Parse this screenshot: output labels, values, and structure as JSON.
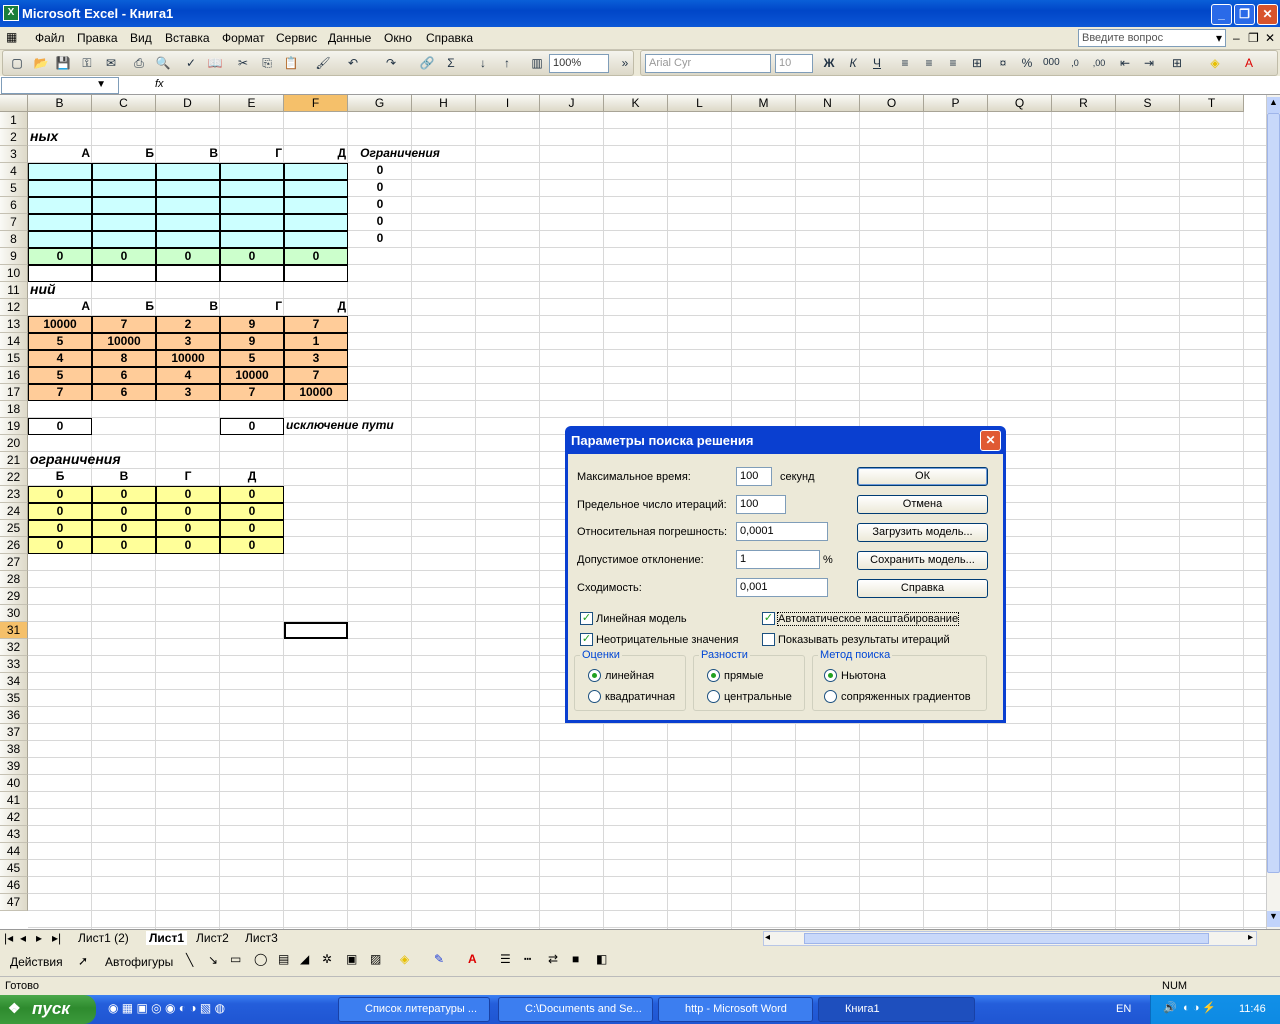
{
  "window": {
    "title": "Microsoft Excel - Книга1"
  },
  "menu": {
    "items": [
      "Файл",
      "Правка",
      "Вид",
      "Вставка",
      "Формат",
      "Сервис",
      "Данные",
      "Окно",
      "Справка"
    ],
    "ask_placeholder": "Введите вопрос"
  },
  "toolbar": {
    "zoom": "100%",
    "font": "Arial Cyr",
    "size": "10"
  },
  "formula": {
    "fx": "fx"
  },
  "columns": [
    "B",
    "C",
    "D",
    "E",
    "F",
    "G",
    "H",
    "I",
    "J",
    "K",
    "L",
    "M",
    "N",
    "O",
    "P",
    "Q",
    "R",
    "S",
    "T"
  ],
  "selected_column": "F",
  "selected_row": 31,
  "rows_count": 47,
  "cells": {
    "r2_label": "ных",
    "r3": [
      "А",
      "Б",
      "В",
      "Г",
      "Д"
    ],
    "r3_g": "Ограничения",
    "g4_8": [
      "0",
      "0",
      "0",
      "0",
      "0"
    ],
    "r9": [
      "0",
      "0",
      "0",
      "0",
      "0"
    ],
    "r11_label": "ний",
    "r12": [
      "А",
      "Б",
      "В",
      "Г",
      "Д"
    ],
    "matrix": [
      [
        "10000",
        "7",
        "2",
        "9",
        "7"
      ],
      [
        "5",
        "10000",
        "3",
        "9",
        "1"
      ],
      [
        "4",
        "8",
        "10000",
        "5",
        "3"
      ],
      [
        "5",
        "6",
        "4",
        "10000",
        "7"
      ],
      [
        "7",
        "6",
        "3",
        "7",
        "10000"
      ]
    ],
    "b19": "0",
    "e19": "0",
    "f19_label": "исключение пути",
    "r21_label": "ограничения",
    "r22": [
      "Б",
      "В",
      "Г",
      "Д"
    ],
    "yellow": [
      [
        "0",
        "0",
        "0",
        "0"
      ],
      [
        "0",
        "0",
        "0",
        "0"
      ],
      [
        "0",
        "0",
        "0",
        "0"
      ],
      [
        "0",
        "0",
        "0",
        "0"
      ]
    ]
  },
  "sheet_tabs": [
    "Лист1 (2)",
    "Лист1",
    "Лист2",
    "Лист3"
  ],
  "active_sheet": "Лист1",
  "drawing": {
    "actions": "Действия",
    "autoshapes": "Автофигуры"
  },
  "status": {
    "ready": "Готово",
    "num": "NUM"
  },
  "taskbar": {
    "start": "пуск",
    "tasks": [
      "Список литературы ...",
      "C:\\Documents and Se...",
      "http - Microsoft Word",
      "Книга1"
    ],
    "lang": "EN",
    "time": "11:46"
  },
  "dialog": {
    "title": "Параметры поиска решения",
    "fields": [
      {
        "label": "Максимальное время:",
        "value": "100",
        "unit": "секунд"
      },
      {
        "label": "Предельное число итераций:",
        "value": "100",
        "unit": ""
      },
      {
        "label": "Относительная погрешность:",
        "value": "0,0001",
        "unit": ""
      },
      {
        "label": "Допустимое отклонение:",
        "value": "1",
        "unit": "%"
      },
      {
        "label": "Сходимость:",
        "value": "0,001",
        "unit": ""
      }
    ],
    "buttons": [
      "ОК",
      "Отмена",
      "Загрузить модель...",
      "Сохранить модель...",
      "Справка"
    ],
    "checks": [
      {
        "label": "Линейная модель",
        "checked": true
      },
      {
        "label": "Автоматическое масштабирование",
        "checked": true
      },
      {
        "label": "Неотрицательные значения",
        "checked": true
      },
      {
        "label": "Показывать результаты итераций",
        "checked": false
      }
    ],
    "groups": [
      {
        "title": "Оценки",
        "options": [
          "линейная",
          "квадратичная"
        ],
        "selected": 0
      },
      {
        "title": "Разности",
        "options": [
          "прямые",
          "центральные"
        ],
        "selected": 0
      },
      {
        "title": "Метод поиска",
        "options": [
          "Ньютона",
          "сопряженных градиентов"
        ],
        "selected": 0
      }
    ]
  }
}
